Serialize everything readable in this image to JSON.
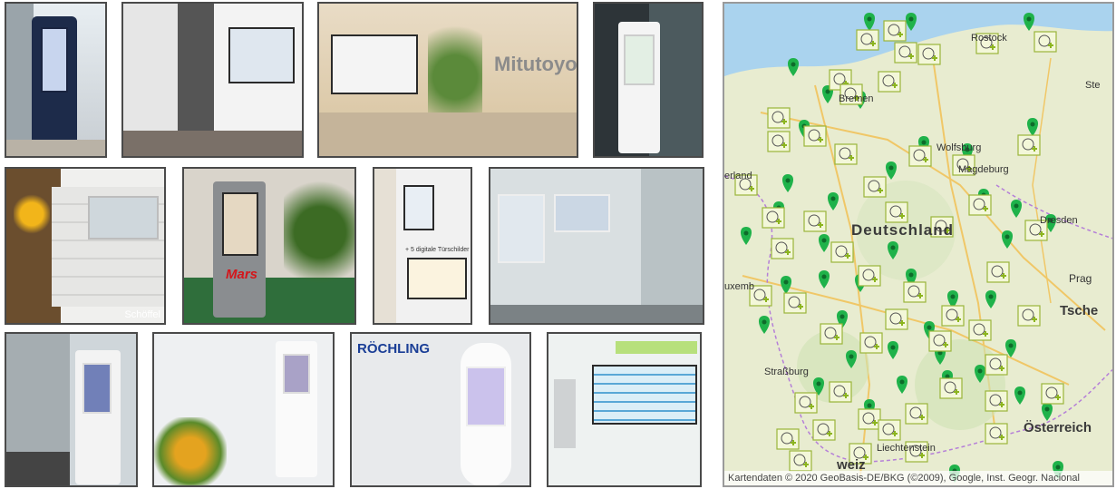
{
  "photos": {
    "mitutoyo_sign": "Mitutoyo",
    "schoffel_watermark": "Schöffel",
    "mars_logo": "Mars",
    "roechling_sign": "RÖCHLING",
    "door_sign_caption": "+ 5 digitale Türschilder"
  },
  "map": {
    "labels": {
      "rostock": "Rostock",
      "bremen": "Bremen",
      "wolfsburg": "Wolfsburg",
      "magdeburg": "Magdeburg",
      "deutschland": "Deutschland",
      "dresden": "Dresden",
      "prag": "Prag",
      "tsche": "Tsche",
      "luxemburg": "uxemb",
      "strassburg": "Straßburg",
      "liechtenstein": "Liechtenstein",
      "oesterreich": "Österreich",
      "schweiz": "weiz",
      "stet": "Ste",
      "erland": "erland"
    },
    "attribution": "Kartendaten © 2020 GeoBasis-DE/BKG (©2009), Google, Inst. Geogr. Nacional",
    "colors": {
      "pin": "#1fb24a",
      "icon_bg": "#f3f7d9",
      "icon_border": "#9ab53a",
      "water": "#aad3ee",
      "land": "#e9ecd6"
    }
  }
}
